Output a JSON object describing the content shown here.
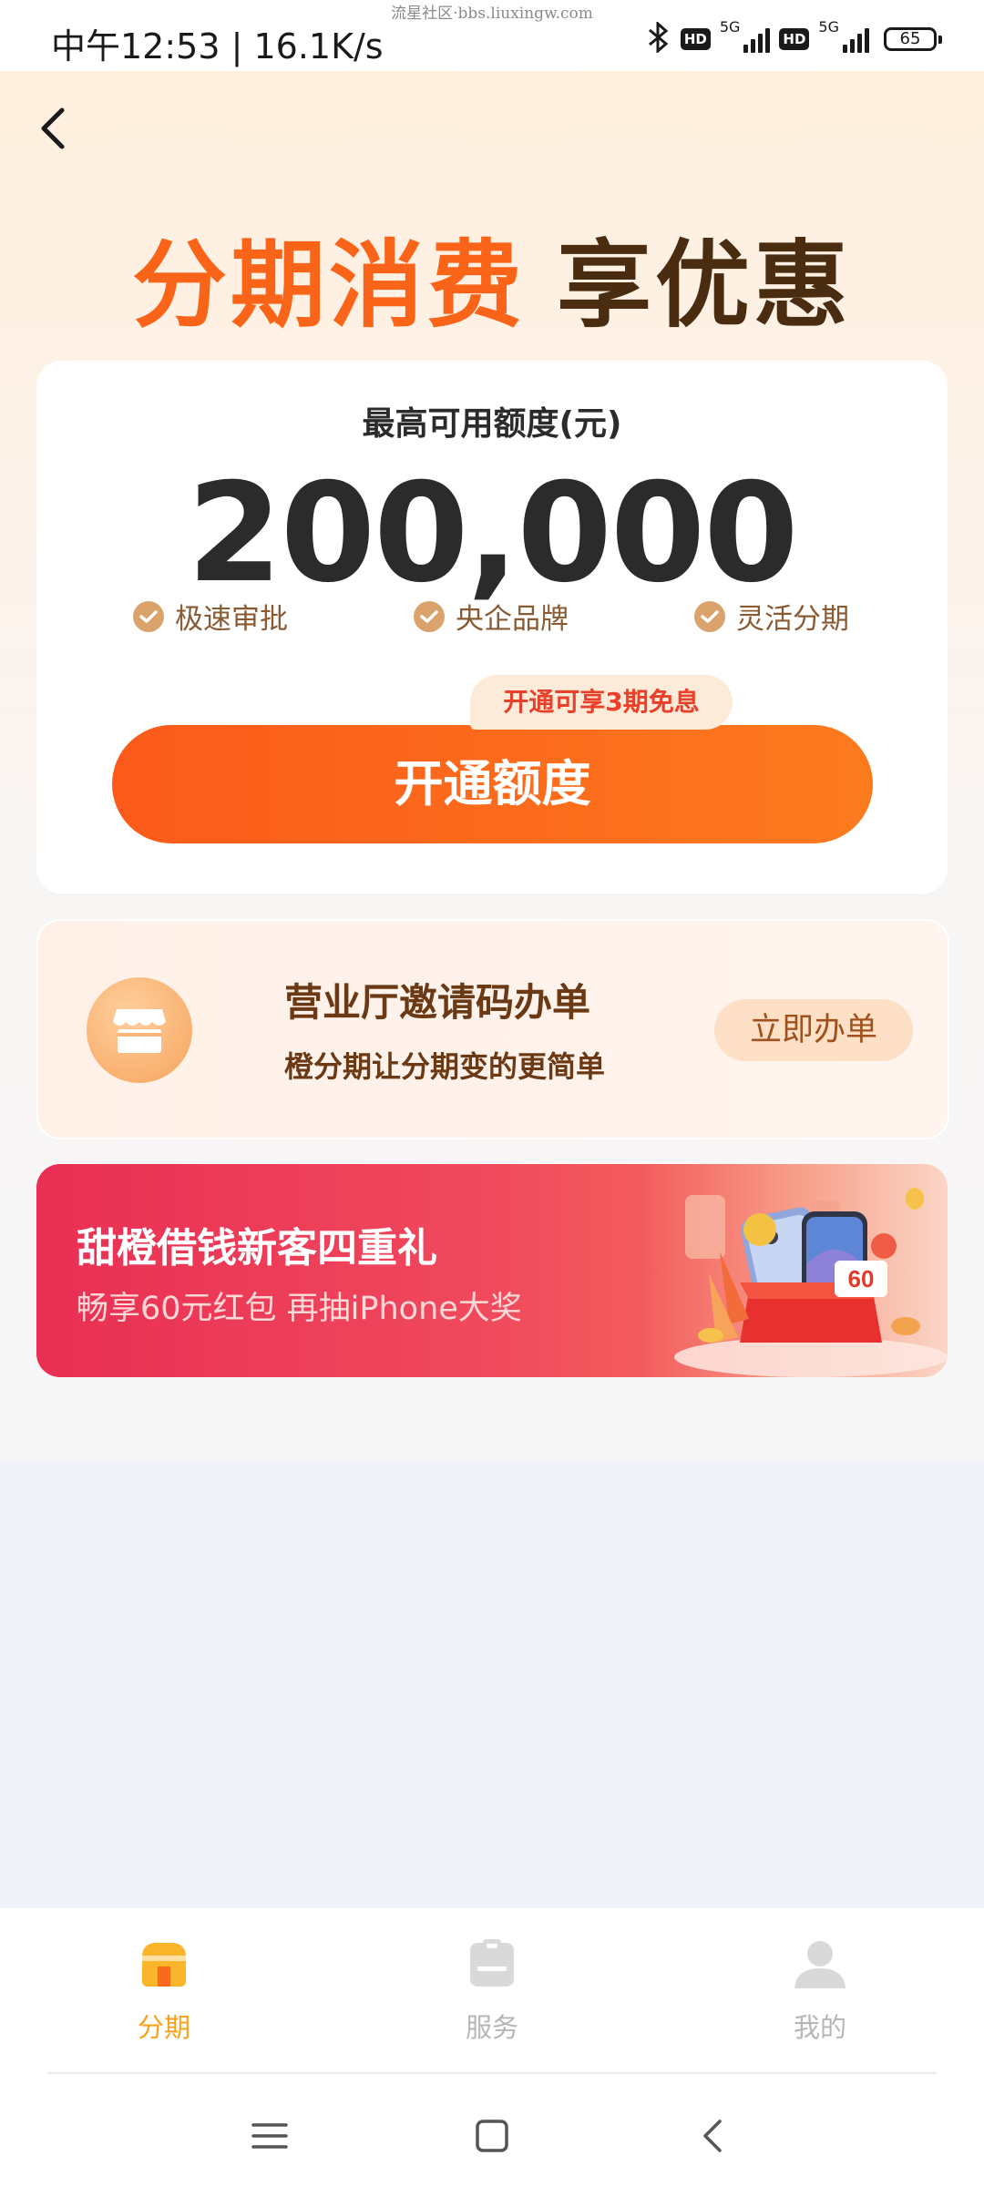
{
  "status_bar": {
    "time": "中午12:53 | 16.1K/s",
    "watermark": "流星社区·bbs.liuxingw.com",
    "hd_badge": "HD",
    "network_label": "5G",
    "battery": "65"
  },
  "hero": {
    "headline_highlight": "分期消费",
    "headline_rest": "享优惠"
  },
  "credit_card": {
    "label": "最高可用额度(元)",
    "amount": "200,000",
    "features": [
      "极速审批",
      "央企品牌",
      "灵活分期"
    ],
    "promo_tag": "开通可享3期免息",
    "open_button": "开通额度"
  },
  "store_card": {
    "title": "营业厅邀请码办单",
    "subtitle": "橙分期让分期变的更简单",
    "button": "立即办单"
  },
  "banner": {
    "title": "甜橙借钱新客四重礼",
    "subtitle": "畅享60元红包 再抽iPhone大奖",
    "badge": "60"
  },
  "tab_bar": {
    "tabs": [
      {
        "label": "分期",
        "icon": "installment-icon",
        "active": true
      },
      {
        "label": "服务",
        "icon": "service-icon",
        "active": false
      },
      {
        "label": "我的",
        "icon": "profile-icon",
        "active": false
      }
    ]
  },
  "colors": {
    "accent_orange": "#fa6418",
    "brand_brown": "#4a2c10",
    "tab_active": "#f8a21c",
    "banner_red": "#e92f54"
  }
}
